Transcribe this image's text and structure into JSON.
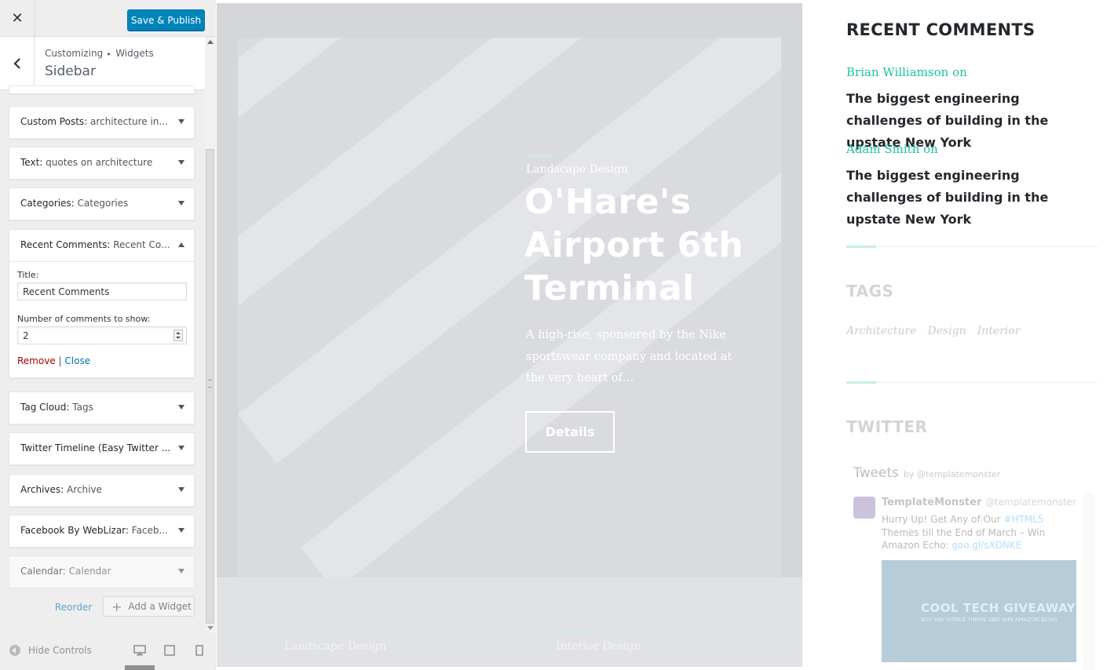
{
  "customizer": {
    "close_glyph": "✕",
    "publish_label": "Save & Publish",
    "breadcrumb": {
      "root": "Customizing",
      "separator": "▸",
      "current": "Widgets"
    },
    "section_title": "Sidebar",
    "widgets": [
      {
        "type": "Custom Posts:",
        "name": "architecture in..."
      },
      {
        "type": "Text:",
        "name": "quotes on architecture"
      },
      {
        "type": "Categories:",
        "name": "Categories"
      },
      {
        "type": "Recent Comments:",
        "name": "Recent Co...",
        "expanded": true
      },
      {
        "type": "Tag Cloud:",
        "name": "Tags"
      },
      {
        "type": "Twitter Timeline (Easy Twitter ...",
        "name": ""
      },
      {
        "type": "Archives:",
        "name": "Archive"
      },
      {
        "type": "Facebook By WebLizar:",
        "name": "Faceb..."
      },
      {
        "type": "Calendar:",
        "name": "Calendar"
      }
    ],
    "recent_comments_form": {
      "title_label": "Title:",
      "title_value": "Recent Comments",
      "count_label": "Number of comments to show:",
      "count_value": "2",
      "remove_label": "Remove",
      "separator": "|",
      "close_label": "Close"
    },
    "reorder_label": "Reorder",
    "add_widget_label": "Add a Widget",
    "hide_controls_label": "Hide Controls",
    "colors": {
      "primary": "#0085ba",
      "remove": "#aa0000",
      "link": "#0073aa"
    }
  },
  "preview": {
    "hero": {
      "category": "Landscape Design",
      "title": "O'Hare's Airport 6th Terminal",
      "description": "A high-rise, sponsored by the Nike sportswear company and located at the very heart of…",
      "button_label": "Details",
      "footer_labels": [
        "Landscape Design",
        "Interior Design"
      ]
    },
    "sidebar": {
      "recent_comments_title": "RECENT COMMENTS",
      "comments": [
        {
          "author": "Brian Williamson",
          "on": "on",
          "post": "The biggest engineering challenges of building in the upstate New York"
        },
        {
          "author": "Adam Smith",
          "on": "on",
          "post": "The biggest engineering challenges of building in the upstate New York"
        }
      ],
      "tags_title": "TAGS",
      "tags": [
        "Architecture",
        "Design",
        "Interior"
      ],
      "twitter_title": "TWITTER",
      "tweets_label": "Tweets",
      "tweets_by": "by @templatemonster",
      "tweet": {
        "name": "TemplateMonster",
        "handle": "@templatemonster",
        "text_part1": "Hurry Up! Get Any of Our",
        "hashtag": "#HTML5",
        "text_part2": "Themes till the End of March – Win Amazon Echo:",
        "link": "goo.gl/sXDNKE",
        "image_title": "COOL TECH GIVEAWAY",
        "image_sub": "BUY ANY HTML5 THEME AND WIN AMAZON ECHO"
      },
      "accent_color": "#1dc3a0"
    }
  }
}
